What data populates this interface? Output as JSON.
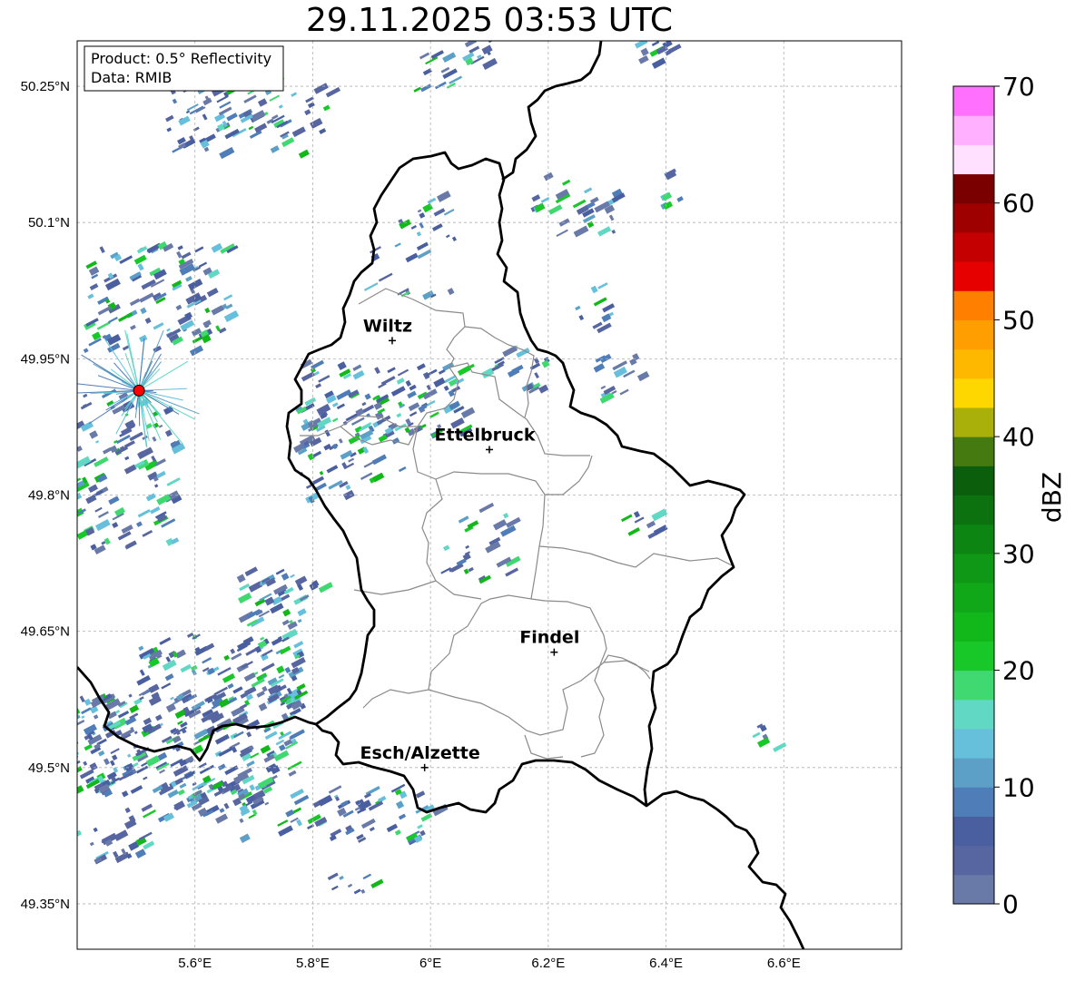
{
  "title": "29.11.2025 03:53 UTC",
  "info_box": {
    "line1": "Product: 0.5° Reflectivity",
    "line2": "Data: RMIB"
  },
  "lat_ticks": [
    "50.25°N",
    "50.1°N",
    "49.95°N",
    "49.8°N",
    "49.65°N",
    "49.5°N",
    "49.35°N"
  ],
  "lon_ticks": [
    "5.6°E",
    "5.8°E",
    "6°E",
    "6.2°E",
    "6.4°E",
    "6.6°E"
  ],
  "cities": [
    {
      "name": "Wiltz",
      "lon": 5.935,
      "lat": 49.97
    },
    {
      "name": "Ettelbruck",
      "lon": 6.1,
      "lat": 49.85
    },
    {
      "name": "Findel",
      "lon": 6.21,
      "lat": 49.627
    },
    {
      "name": "Esch/Alzette",
      "lon": 5.99,
      "lat": 49.5
    }
  ],
  "radar_site": {
    "lon": 5.505,
    "lat": 49.915,
    "color": "#ff0000"
  },
  "colorbar": {
    "label": "dBZ",
    "ticks": [
      "0",
      "10",
      "20",
      "30",
      "40",
      "50",
      "60",
      "70"
    ],
    "min": 0,
    "max": 70,
    "step": 2.5,
    "colors": [
      "#6a7aa8",
      "#5766a0",
      "#4a5fa0",
      "#4f7db8",
      "#5ca0c8",
      "#66c0dc",
      "#60d8c4",
      "#40d870",
      "#18c828",
      "#12b81a",
      "#10a818",
      "#0f9815",
      "#0d8512",
      "#0c7210",
      "#0a5e0c",
      "#447a10",
      "#aab00a",
      "#ffd700",
      "#ffb800",
      "#ff9e00",
      "#ff8000",
      "#e60000",
      "#c40000",
      "#9e0000",
      "#7a0000",
      "#ffe0ff",
      "#ffb0ff",
      "#ff70ff",
      "#e832e8"
    ]
  },
  "extent": {
    "lon": [
      5.4,
      6.8
    ],
    "lat": [
      49.3,
      50.3
    ]
  }
}
